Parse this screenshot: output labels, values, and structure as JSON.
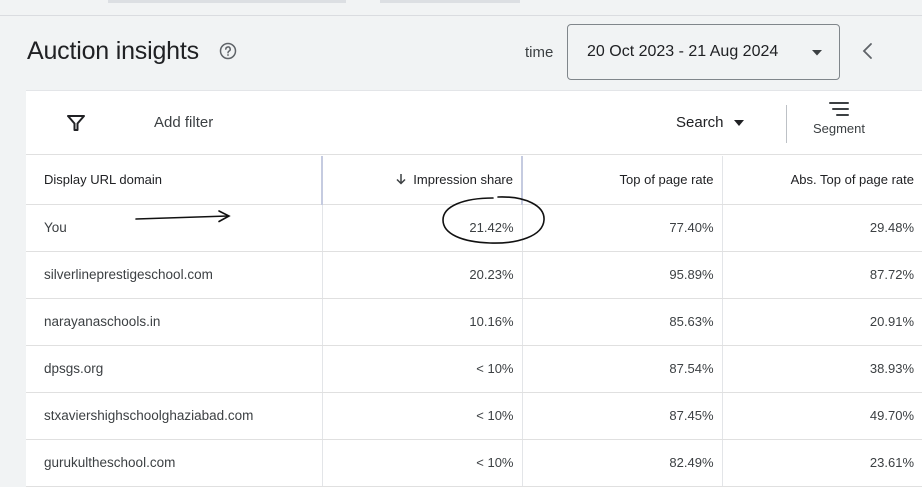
{
  "header": {
    "title": "Auction insights",
    "time_label": "time",
    "date_range": "20 Oct 2023 - 21 Aug 2024"
  },
  "toolbar": {
    "add_filter": "Add filter",
    "search": "Search",
    "segment": "Segment"
  },
  "table": {
    "columns": [
      "Display URL domain",
      "Impression share",
      "Top of page rate",
      "Abs. Top of page rate"
    ],
    "sort_column": "Impression share",
    "sort_direction": "descending",
    "rows": [
      {
        "domain": "You",
        "impression_share": "21.42%",
        "top_of_page_rate": "77.40%",
        "abs_top_of_page_rate": "29.48%"
      },
      {
        "domain": "silverlineprestigeschool.com",
        "impression_share": "20.23%",
        "top_of_page_rate": "95.89%",
        "abs_top_of_page_rate": "87.72%"
      },
      {
        "domain": "narayanaschools.in",
        "impression_share": "10.16%",
        "top_of_page_rate": "85.63%",
        "abs_top_of_page_rate": "20.91%"
      },
      {
        "domain": "dpsgs.org",
        "impression_share": "< 10%",
        "top_of_page_rate": "87.54%",
        "abs_top_of_page_rate": "38.93%"
      },
      {
        "domain": "stxaviershighschoolghaziabad.com",
        "impression_share": "< 10%",
        "top_of_page_rate": "87.45%",
        "abs_top_of_page_rate": "49.70%"
      },
      {
        "domain": "gurukultheschool.com",
        "impression_share": "< 10%",
        "top_of_page_rate": "82.49%",
        "abs_top_of_page_rate": "23.61%"
      }
    ]
  },
  "icons": {
    "help": "help-circle-icon",
    "date_caret": "caret-down-icon",
    "back": "chevron-left-icon",
    "filter": "filter-funnel-icon",
    "search_caret": "caret-down-icon",
    "segment": "segment-lines-icon",
    "sort": "arrow-down-icon"
  },
  "colors": {
    "background": "#f1f3f4",
    "card": "#ffffff",
    "text": "#202124",
    "muted_text": "#3c4043",
    "divider": "#e0e0e0",
    "annotation": "#111111"
  }
}
